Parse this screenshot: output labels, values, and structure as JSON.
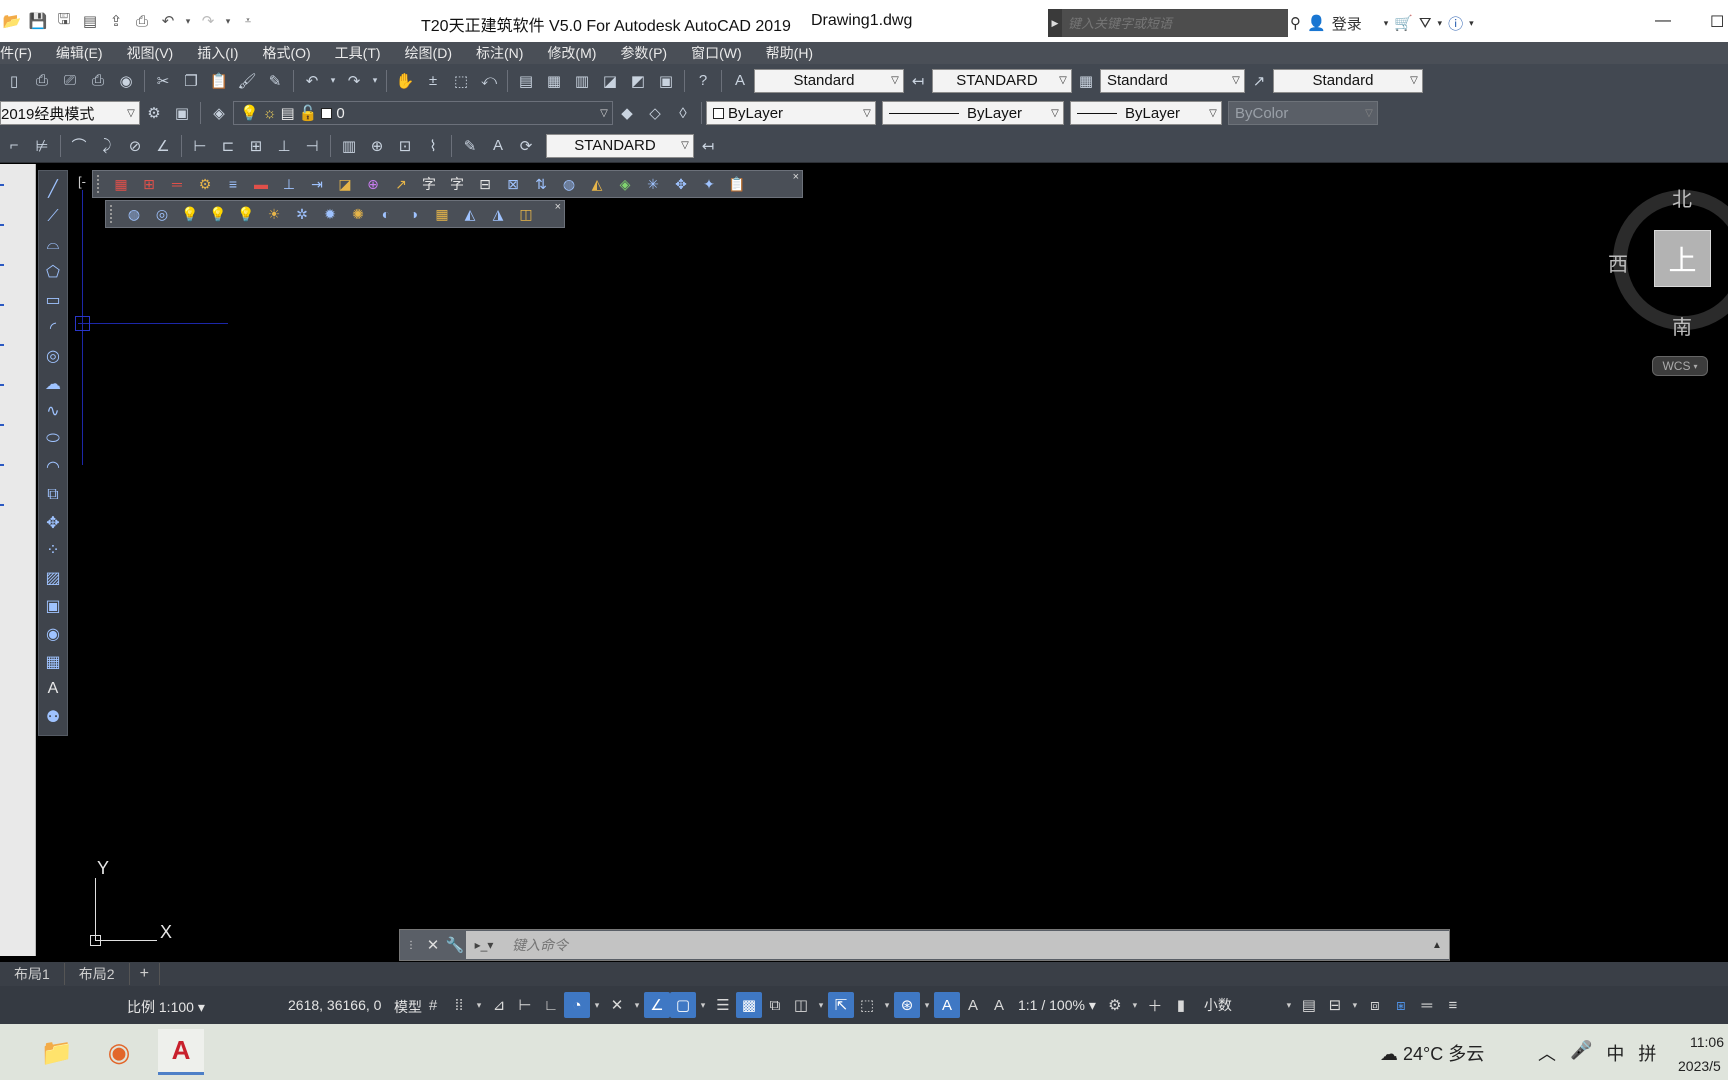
{
  "window": {
    "title": "T20天正建筑软件 V5.0 For Autodesk AutoCAD 2019",
    "filename": "Drawing1.dwg",
    "search_placeholder": "键入关键字或短语",
    "login_label": "登录",
    "minimize_glyph": "—",
    "maximize_glyph": "☐"
  },
  "menu": [
    "件(F)",
    "编辑(E)",
    "视图(V)",
    "插入(I)",
    "格式(O)",
    "工具(T)",
    "绘图(D)",
    "标注(N)",
    "修改(M)",
    "参数(P)",
    "窗口(W)",
    "帮助(H)"
  ],
  "toolbar1": {
    "text_style": "Standard",
    "dim_style": "STANDARD",
    "table_style": "Standard",
    "mleader_style": "Standard"
  },
  "toolbar2": {
    "workspace": "2019经典模式",
    "layer": "0",
    "color": "ByLayer",
    "linetype": "ByLayer",
    "lineweight": "ByLayer",
    "plotstyle": "ByColor"
  },
  "toolbar3": {
    "dim_style": "STANDARD"
  },
  "drawing": {
    "view_label": "[-",
    "viewcube": {
      "north": "北",
      "south": "南",
      "west": "西",
      "face": "上"
    },
    "wcs_label": "WCS",
    "ucs_x": "X",
    "ucs_y": "Y"
  },
  "command": {
    "placeholder": "键入命令"
  },
  "tabs": [
    "布局1",
    "布局2",
    "+"
  ],
  "status": {
    "scale": "比例 1:100",
    "coords": "2618, 36166, 0",
    "model": "模型",
    "annotation_scale": "1:1 / 100%",
    "units": "小数"
  },
  "taskbar": {
    "weather": "24°C  多云",
    "ime_lang": "中",
    "ime_mode": "拼",
    "time": "11:06",
    "date": "2023/5"
  },
  "colors": {
    "titlebar": "#ffffff",
    "menubar": "#4a4f57",
    "toolbar": "#424851",
    "canvas": "#000000",
    "statusbar": "#353a42",
    "accent": "#3f78c4"
  }
}
